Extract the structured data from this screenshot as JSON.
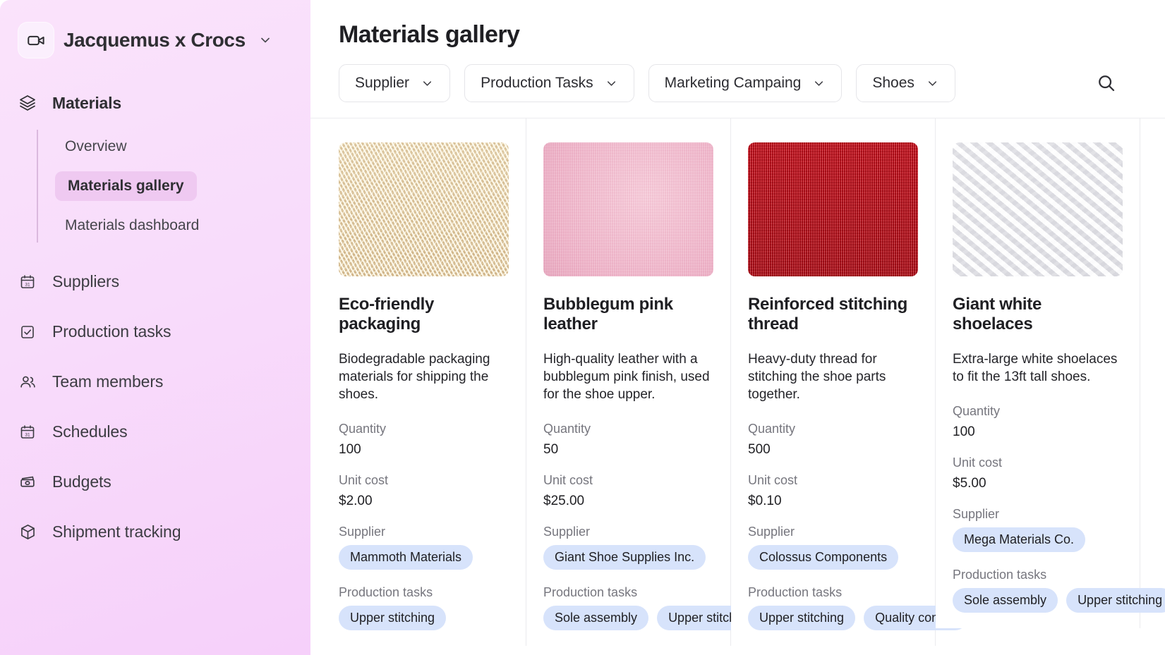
{
  "sidebar": {
    "workspace": {
      "name": "Jacquemus x Crocs",
      "logo_icon": "video-camera-icon",
      "caret_icon": "chevron-down-icon"
    },
    "group": {
      "label": "Materials",
      "icon": "layers-icon",
      "sub_items": [
        {
          "label": "Overview",
          "active": false
        },
        {
          "label": "Materials gallery",
          "active": true
        },
        {
          "label": "Materials dashboard",
          "active": false
        }
      ]
    },
    "items": [
      {
        "label": "Suppliers",
        "icon": "calendar-icon"
      },
      {
        "label": "Production tasks",
        "icon": "checkbox-icon"
      },
      {
        "label": "Team members",
        "icon": "users-icon"
      },
      {
        "label": "Schedules",
        "icon": "calendar-icon"
      },
      {
        "label": "Budgets",
        "icon": "money-icon"
      },
      {
        "label": "Shipment tracking",
        "icon": "package-icon"
      }
    ]
  },
  "header": {
    "title": "Materials gallery"
  },
  "filters": [
    {
      "label": "Supplier",
      "icon": "chevron-down-icon"
    },
    {
      "label": "Production Tasks",
      "icon": "chevron-down-icon"
    },
    {
      "label": "Marketing Campaing",
      "icon": "chevron-down-icon"
    },
    {
      "label": "Shoes",
      "icon": "chevron-down-icon"
    }
  ],
  "search": {
    "icon": "search-icon"
  },
  "labels": {
    "quantity": "Quantity",
    "unit_cost": "Unit cost",
    "supplier": "Supplier",
    "production_tasks": "Production tasks"
  },
  "cards": [
    {
      "title": "Eco-friendly packaging",
      "description": "Biodegradable packaging materials for shipping the shoes.",
      "quantity": "100",
      "unit_cost": "$2.00",
      "supplier": "Mammoth Materials",
      "tasks": [
        "Upper stitching"
      ],
      "image_style": "img-straw",
      "image_alt": "wood-wool-packaging-photo"
    },
    {
      "title": "Bubblegum pink leather",
      "description": "High-quality leather with a bubblegum pink finish, used for the shoe upper.",
      "quantity": "50",
      "unit_cost": "$25.00",
      "supplier": "Giant Shoe Supplies Inc.",
      "tasks": [
        "Sole assembly",
        "Upper stitching"
      ],
      "image_style": "img-pink",
      "image_alt": "pink-leather-photo"
    },
    {
      "title": "Reinforced stitching thread",
      "description": "Heavy-duty thread for stitching the shoe parts together.",
      "quantity": "500",
      "unit_cost": "$0.10",
      "supplier": "Colossus Components",
      "tasks": [
        "Upper stitching",
        "Quality control"
      ],
      "image_style": "img-red",
      "image_alt": "red-thread-photo"
    },
    {
      "title": "Giant white shoelaces",
      "description": "Extra-large white shoelaces to fit the 13ft tall shoes.",
      "quantity": "100",
      "unit_cost": "$5.00",
      "supplier": "Mega Materials Co.",
      "tasks": [
        "Sole assembly",
        "Upper stitching"
      ],
      "image_style": "img-white",
      "image_alt": "white-shoelaces-photo"
    }
  ],
  "colors": {
    "sidebar_top": "#fae3fb",
    "sidebar_bottom": "#f6d0fa",
    "active_pill": "#efc9f1",
    "tag_bg": "#d7e3fb",
    "text_primary": "#1f1f23",
    "text_muted": "#76767e"
  }
}
